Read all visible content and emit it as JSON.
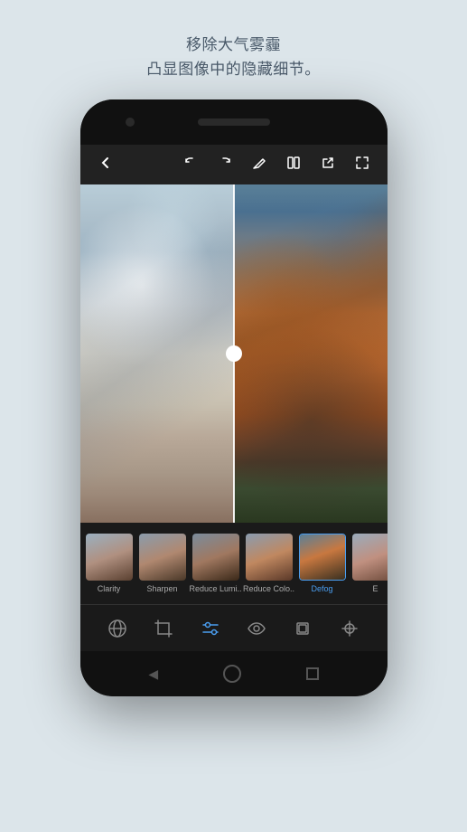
{
  "page": {
    "background_color": "#dce5ea"
  },
  "header": {
    "title_line1": "移除大气雾霾",
    "title_line2": "凸显图像中的隐藏细节。"
  },
  "toolbar": {
    "back_icon": "←",
    "undo_icon": "↩",
    "redo_icon": "↪",
    "edit_icon": "✎",
    "compare_icon": "⊞",
    "share_icon": "↗",
    "fullscreen_icon": "⛶"
  },
  "thumbnails": [
    {
      "label": "Clarity",
      "active": false
    },
    {
      "label": "Sharpen",
      "active": false
    },
    {
      "label": "Reduce Lumi..",
      "active": false
    },
    {
      "label": "Reduce Colo..",
      "active": false
    },
    {
      "label": "Defog",
      "active": true
    },
    {
      "label": "E",
      "active": false
    }
  ],
  "bottom_tools": [
    {
      "name": "globe-icon",
      "active": false,
      "symbol": "🌐"
    },
    {
      "name": "crop-icon",
      "active": false,
      "symbol": "⊞"
    },
    {
      "name": "adjust-icon",
      "active": true,
      "symbol": "≡"
    },
    {
      "name": "eye-icon",
      "active": false,
      "symbol": "👁"
    },
    {
      "name": "layers-icon",
      "active": false,
      "symbol": "⊡"
    },
    {
      "name": "heal-icon",
      "active": false,
      "symbol": "✦"
    }
  ],
  "nav": {
    "back": "◀",
    "home": "",
    "recent": "■"
  }
}
